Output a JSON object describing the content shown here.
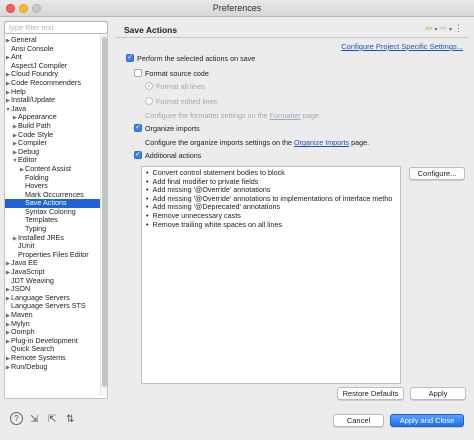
{
  "window": {
    "title": "Preferences"
  },
  "sidebar": {
    "filter_placeholder": "type filter text",
    "items": [
      {
        "label": "General",
        "arrow": "▶",
        "indent": 0
      },
      {
        "label": "Ansi Console",
        "arrow": "",
        "indent": 0
      },
      {
        "label": "Ant",
        "arrow": "▶",
        "indent": 0
      },
      {
        "label": "AspectJ Compiler",
        "arrow": "",
        "indent": 0
      },
      {
        "label": "Cloud Foundry",
        "arrow": "▶",
        "indent": 0
      },
      {
        "label": "Code Recommenders",
        "arrow": "▶",
        "indent": 0
      },
      {
        "label": "Help",
        "arrow": "▶",
        "indent": 0
      },
      {
        "label": "Install/Update",
        "arrow": "▶",
        "indent": 0
      },
      {
        "label": "Java",
        "arrow": "▼",
        "indent": 0
      },
      {
        "label": "Appearance",
        "arrow": "▶",
        "indent": 1
      },
      {
        "label": "Build Path",
        "arrow": "▶",
        "indent": 1
      },
      {
        "label": "Code Style",
        "arrow": "▶",
        "indent": 1
      },
      {
        "label": "Compiler",
        "arrow": "▶",
        "indent": 1
      },
      {
        "label": "Debug",
        "arrow": "▶",
        "indent": 1
      },
      {
        "label": "Editor",
        "arrow": "▼",
        "indent": 1
      },
      {
        "label": "Content Assist",
        "arrow": "▶",
        "indent": 2
      },
      {
        "label": "Folding",
        "arrow": "",
        "indent": 2
      },
      {
        "label": "Hovers",
        "arrow": "",
        "indent": 2
      },
      {
        "label": "Mark Occurrences",
        "arrow": "",
        "indent": 2
      },
      {
        "label": "Save Actions",
        "arrow": "",
        "indent": 2,
        "selected": true
      },
      {
        "label": "Syntax Coloring",
        "arrow": "",
        "indent": 2
      },
      {
        "label": "Templates",
        "arrow": "",
        "indent": 2
      },
      {
        "label": "Typing",
        "arrow": "",
        "indent": 2
      },
      {
        "label": "Installed JREs",
        "arrow": "▶",
        "indent": 1
      },
      {
        "label": "JUnit",
        "arrow": "",
        "indent": 1
      },
      {
        "label": "Properties Files Editor",
        "arrow": "",
        "indent": 1
      },
      {
        "label": "Java EE",
        "arrow": "▶",
        "indent": 0
      },
      {
        "label": "JavaScript",
        "arrow": "▶",
        "indent": 0
      },
      {
        "label": "JDT Weaving",
        "arrow": "",
        "indent": 0
      },
      {
        "label": "JSON",
        "arrow": "▶",
        "indent": 0
      },
      {
        "label": "Language Servers",
        "arrow": "▶",
        "indent": 0
      },
      {
        "label": "Language Servers STS",
        "arrow": "",
        "indent": 0
      },
      {
        "label": "Maven",
        "arrow": "▶",
        "indent": 0
      },
      {
        "label": "Mylyn",
        "arrow": "▶",
        "indent": 0
      },
      {
        "label": "Oomph",
        "arrow": "▶",
        "indent": 0
      },
      {
        "label": "Plug-in Development",
        "arrow": "▶",
        "indent": 0
      },
      {
        "label": "Quick Search",
        "arrow": "",
        "indent": 0
      },
      {
        "label": "Remote Systems",
        "arrow": "▶",
        "indent": 0
      },
      {
        "label": "Run/Debug",
        "arrow": "▶",
        "indent": 0
      }
    ]
  },
  "page": {
    "title": "Save Actions",
    "nav_icons": [
      "back-icon",
      "dropdown-icon",
      "forward-icon",
      "dropdown-icon",
      "menu-icon"
    ],
    "configure_link": "Configure Project Specific Settings...",
    "perform_label": "Perform the selected actions on save",
    "format_label": "Format source code",
    "format_all": "Format all lines",
    "format_edited": "Format edited lines",
    "formatter_text_pre": "Configure the formatter settings on the ",
    "formatter_link": "Formatter",
    "formatter_text_post": " page.",
    "organize_label": "Organize imports",
    "organize_text_pre": "Configure the organize imports settings on the ",
    "organize_link": "Organize Imports",
    "organize_text_post": " page.",
    "additional_label": "Additional actions",
    "additional_items": [
      "Convert control statement bodies to block",
      "Add final modifier to private fields",
      "Add missing '@Override' annotations",
      "Add missing '@Override' annotations to implementations of interface metho",
      "Add missing '@Deprecated' annotations",
      "Remove unnecessary casts",
      "Remove trailing white spaces on all lines"
    ],
    "configure_button": "Configure...",
    "restore_button": "Restore Defaults",
    "apply_button": "Apply"
  },
  "footer": {
    "icons": [
      "help-icon",
      "import-icon",
      "export-icon",
      "import-export-icon"
    ],
    "cancel_button": "Cancel",
    "apply_close_button": "Apply and Close"
  }
}
